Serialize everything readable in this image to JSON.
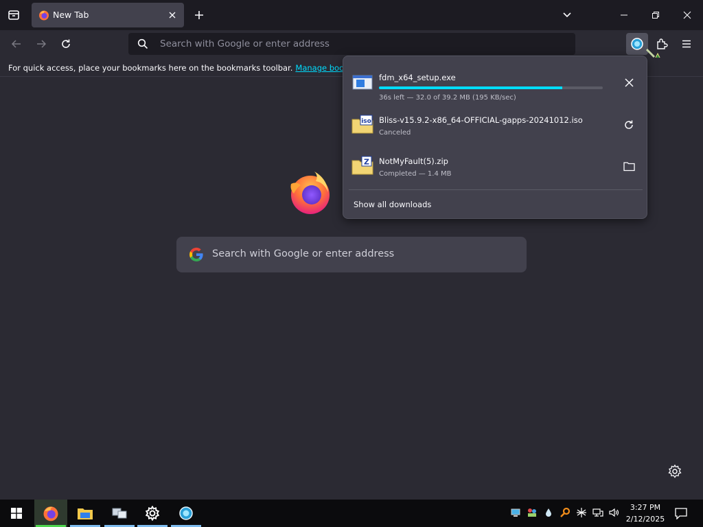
{
  "browser": {
    "tab": {
      "title": "New Tab"
    },
    "urlbar": {
      "placeholder": "Search with Google or enter address"
    },
    "bookmarks_bar": {
      "message": "For quick access, place your bookmarks here on the bookmarks toolbar.",
      "link": "Manage bookmarks"
    },
    "newtab": {
      "search_placeholder": "Search with Google or enter address"
    }
  },
  "downloads_panel": {
    "items": [
      {
        "name": "fdm_x64_setup.exe",
        "status": "36s left — 32.0 of 39.2 MB (195 KB/sec)",
        "progress": 0.82,
        "icon": "exe-file-icon",
        "action": "cancel"
      },
      {
        "name": "Bliss-v15.9.2-x86_64-OFFICIAL-gapps-20241012.iso",
        "status": "Canceled",
        "icon": "iso-file-icon",
        "action": "retry"
      },
      {
        "name": "NotMyFault(5).zip",
        "status": "Completed — 1.4 MB",
        "icon": "zip-file-icon",
        "action": "open-folder"
      }
    ],
    "show_all": "Show all downloads"
  },
  "taskbar": {
    "time": "3:27 PM",
    "date": "2/12/2025"
  },
  "colors": {
    "accent": "#00ddff",
    "chrome_dark": "#1c1b22",
    "content_bg": "#2b2a33",
    "panel_bg": "#42414d"
  }
}
